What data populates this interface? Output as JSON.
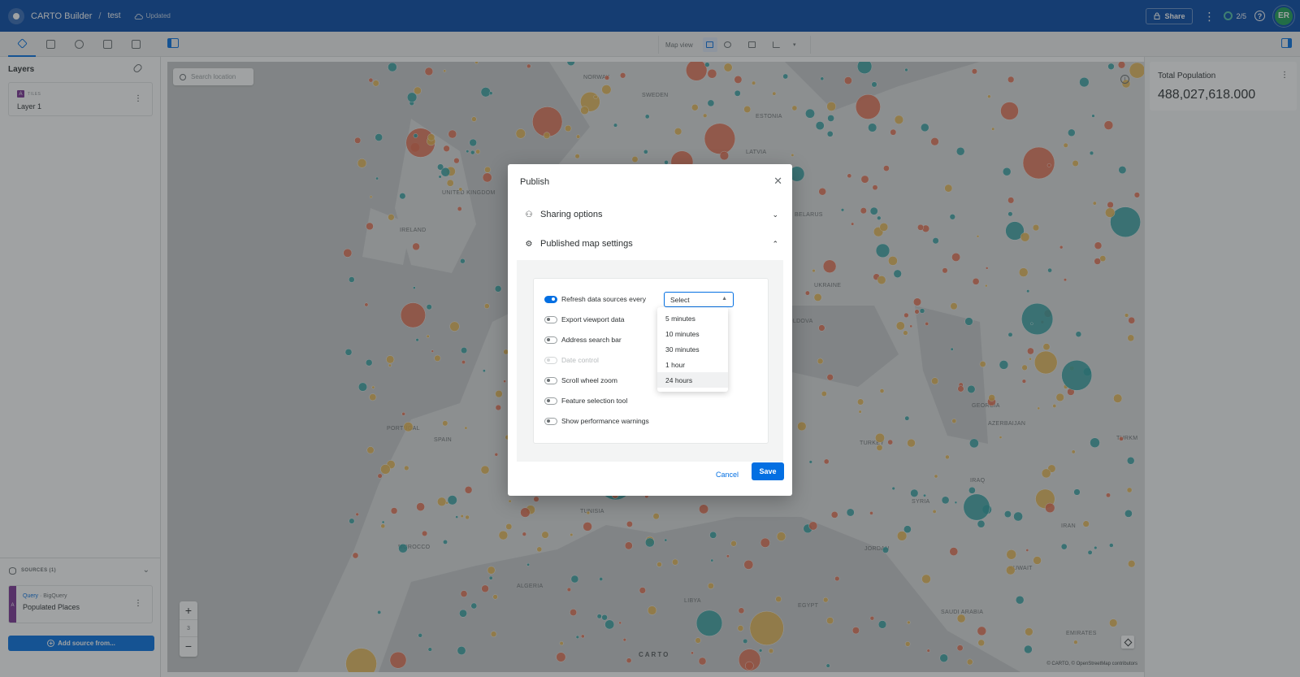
{
  "header": {
    "app_title": "CARTO Builder",
    "separator": "/",
    "map_name": "test",
    "save_status": "Updated",
    "share_label": "Share",
    "quota": "2/5",
    "user_initials": "ER",
    "brand_color": "#0247a6"
  },
  "toolbar": {
    "tabs": [
      "layers-icon",
      "widgets-icon",
      "interactions-icon",
      "legend-icon",
      "basemap-icon"
    ],
    "map_view_label": "Map view"
  },
  "left_panel": {
    "title": "Layers",
    "layer": {
      "badge": "A",
      "type": "TILES",
      "name": "Layer 1"
    },
    "sources_label": "SOURCES (1)",
    "source": {
      "badge": "A",
      "kind_prefix": "Query",
      "kind_suffix": "· BigQuery",
      "name": "Populated Places"
    },
    "add_source_label": "Add source from..."
  },
  "map": {
    "search_placeholder": "Search location",
    "zoom_level": "3",
    "watermark": "CARTO",
    "attribution": "© CARTO, © OpenStreetMap contributors",
    "labels": [
      {
        "text": "NORWAY"
      },
      {
        "text": "SWEDEN"
      },
      {
        "text": "ESTONIA"
      },
      {
        "text": "UNITED KINGDOM"
      },
      {
        "text": "IRELAND"
      },
      {
        "text": "PORTUGAL"
      },
      {
        "text": "SPAIN"
      },
      {
        "text": "MOROCCO"
      },
      {
        "text": "ALGERIA"
      },
      {
        "text": "TUNISIA"
      },
      {
        "text": "LIBYA"
      },
      {
        "text": "EGYPT"
      },
      {
        "text": "SYRIA"
      },
      {
        "text": "JORDAN"
      },
      {
        "text": "IRAQ"
      },
      {
        "text": "IRAN"
      },
      {
        "text": "SAUDI ARABIA"
      },
      {
        "text": "KUWAIT"
      },
      {
        "text": "TURKEY"
      },
      {
        "text": "GEORGIA"
      },
      {
        "text": "AZERBAIJAN"
      },
      {
        "text": "TURKM"
      },
      {
        "text": "UKRAINE"
      },
      {
        "text": "MOLDOVA"
      },
      {
        "text": "BELARUS"
      },
      {
        "text": "LATVIA"
      },
      {
        "text": "EMIRATES"
      }
    ]
  },
  "widget": {
    "title": "Total Population",
    "value": "488,027,618.000"
  },
  "dialog": {
    "title": "Publish",
    "sharing_options": "Sharing options",
    "published_map_settings": "Published map settings",
    "options": [
      {
        "label": "Refresh data sources every",
        "on": true,
        "disabled": false
      },
      {
        "label": "Export viewport data",
        "on": false,
        "disabled": false
      },
      {
        "label": "Address search bar",
        "on": false,
        "disabled": false
      },
      {
        "label": "Date control",
        "on": false,
        "disabled": true
      },
      {
        "label": "Scroll wheel zoom",
        "on": false,
        "disabled": false
      },
      {
        "label": "Feature selection tool",
        "on": false,
        "disabled": false
      },
      {
        "label": "Show performance warnings",
        "on": false,
        "disabled": false
      }
    ],
    "select_value": "Select",
    "dropdown_options": [
      "5 minutes",
      "10 minutes",
      "30 minutes",
      "1 hour",
      "24 hours"
    ],
    "cancel_label": "Cancel",
    "save_label": "Save"
  }
}
